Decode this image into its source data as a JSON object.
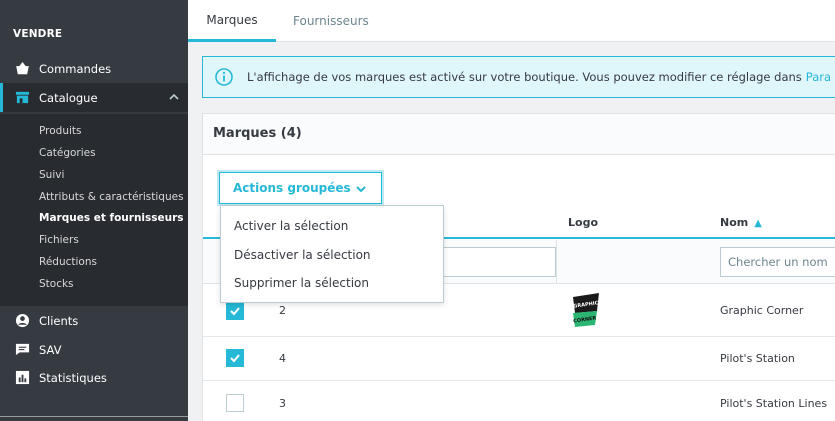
{
  "sidebar": {
    "section_title": "VENDRE",
    "items": [
      {
        "label": "Commandes",
        "icon": "basket-icon"
      },
      {
        "label": "Catalogue",
        "icon": "store-icon"
      },
      {
        "label": "Clients",
        "icon": "user-icon"
      },
      {
        "label": "SAV",
        "icon": "chat-icon"
      },
      {
        "label": "Statistiques",
        "icon": "bar-chart-icon"
      }
    ],
    "catalogue_sub": [
      "Produits",
      "Catégories",
      "Suivi",
      "Attributs & caractéristiques",
      "Marques et fournisseurs",
      "Fichiers",
      "Réductions",
      "Stocks"
    ],
    "current_sub": "Marques et fournisseurs"
  },
  "tabs": [
    {
      "label": "Marques",
      "active": true
    },
    {
      "label": "Fournisseurs",
      "active": false
    }
  ],
  "alert": {
    "text": "L'affichage de vos marques est activé sur votre boutique. Vous pouvez modifier ce réglage dans",
    "link": "Para"
  },
  "card": {
    "title": "Marques (4)",
    "bulk_label": "Actions groupées"
  },
  "dropdown": {
    "items": [
      "Activer la sélection",
      "Désactiver la sélection",
      "Supprimer la sélection"
    ]
  },
  "table": {
    "columns": {
      "logo": "Logo",
      "name": "Nom"
    },
    "name_filter_placeholder": "Chercher un nom",
    "rows": [
      {
        "id": "2",
        "name": "Graphic Corner",
        "checked": true,
        "has_logo": true
      },
      {
        "id": "4",
        "name": "Pilot's Station",
        "checked": true,
        "has_logo": false
      },
      {
        "id": "3",
        "name": "Pilot's Station Lines",
        "checked": false,
        "has_logo": false
      }
    ],
    "logo_text": [
      "GRAPHIC",
      "CORNER"
    ]
  },
  "colors": {
    "accent": "#25b9d7",
    "sidebar": "#363a41",
    "alert_bg": "#dff6fa"
  }
}
